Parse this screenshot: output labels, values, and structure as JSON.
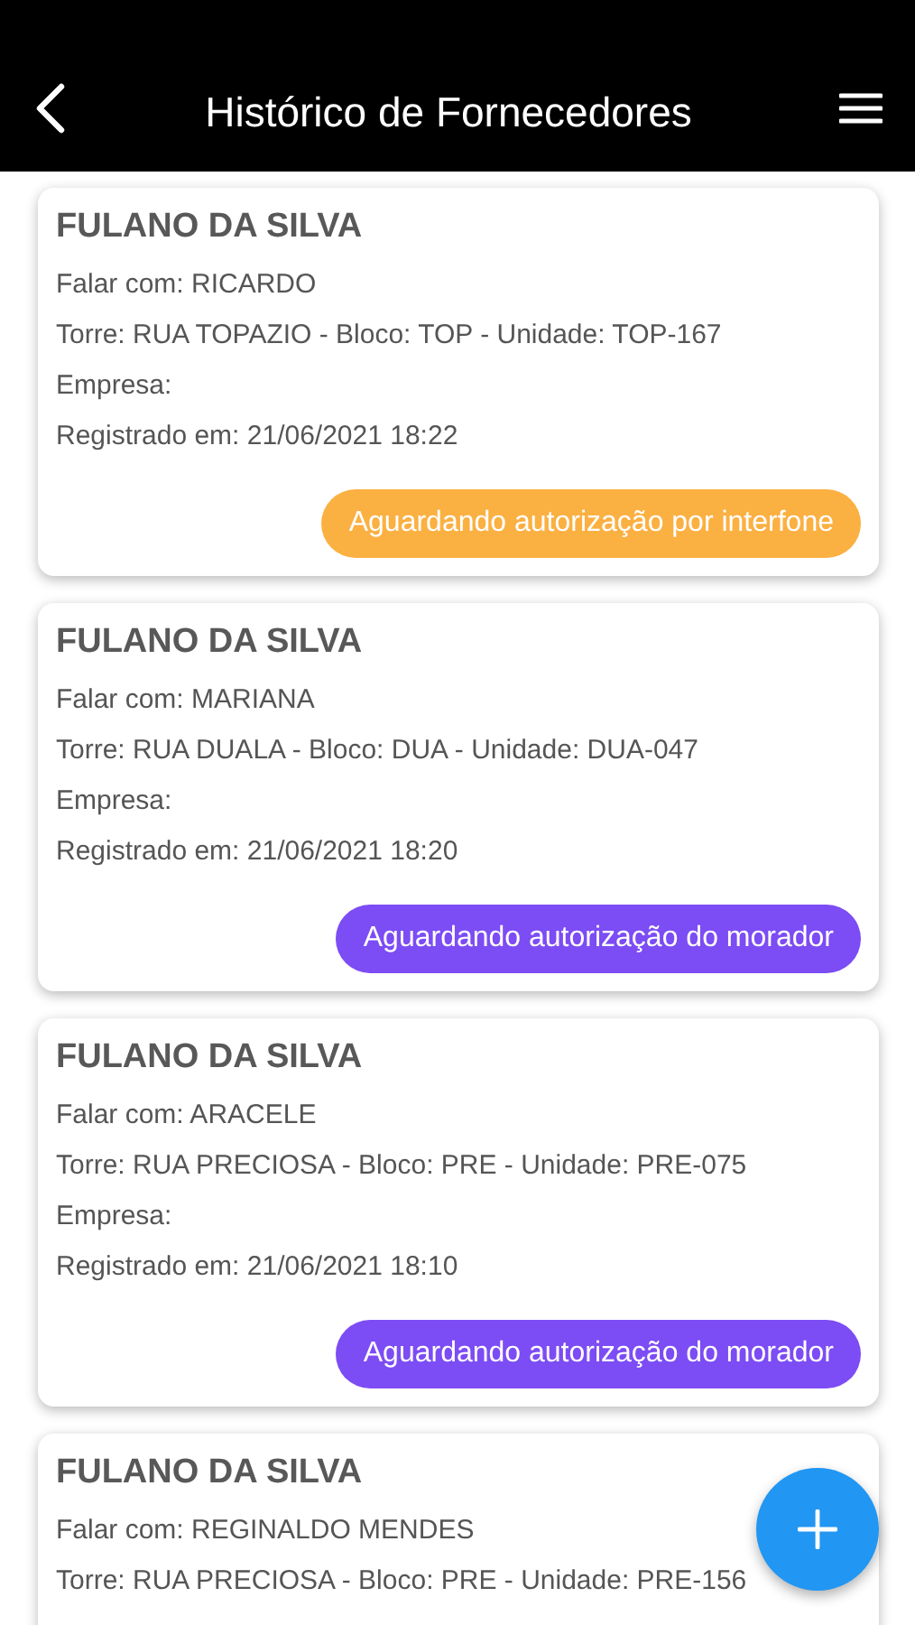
{
  "header": {
    "title": "Histórico de Fornecedores"
  },
  "records": [
    {
      "name": "FULANO DA SILVA",
      "lines": [
        "Falar com: RICARDO",
        "Torre: RUA TOPAZIO - Bloco: TOP - Unidade: TOP-167",
        "Empresa:",
        "Registrado em: 21/06/2021 18:22"
      ],
      "status": {
        "label": "Aguardando autorização por interfone",
        "color": "#fbb042"
      }
    },
    {
      "name": "FULANO DA SILVA",
      "lines": [
        "Falar com: MARIANA",
        "Torre: RUA DUALA - Bloco: DUA - Unidade: DUA-047",
        "Empresa:",
        "Registrado em: 21/06/2021 18:20"
      ],
      "status": {
        "label": "Aguardando autorização do morador",
        "color": "#7c4cf4"
      }
    },
    {
      "name": "FULANO DA SILVA",
      "lines": [
        "Falar com: ARACELE",
        "Torre: RUA PRECIOSA - Bloco: PRE - Unidade: PRE-075",
        "Empresa:",
        "Registrado em: 21/06/2021 18:10"
      ],
      "status": {
        "label": "Aguardando autorização do morador",
        "color": "#7c4cf4"
      }
    },
    {
      "name": "FULANO DA SILVA",
      "lines": [
        "Falar com: REGINALDO MENDES",
        "Torre: RUA PRECIOSA - Bloco: PRE - Unidade: PRE-156"
      ]
    }
  ]
}
